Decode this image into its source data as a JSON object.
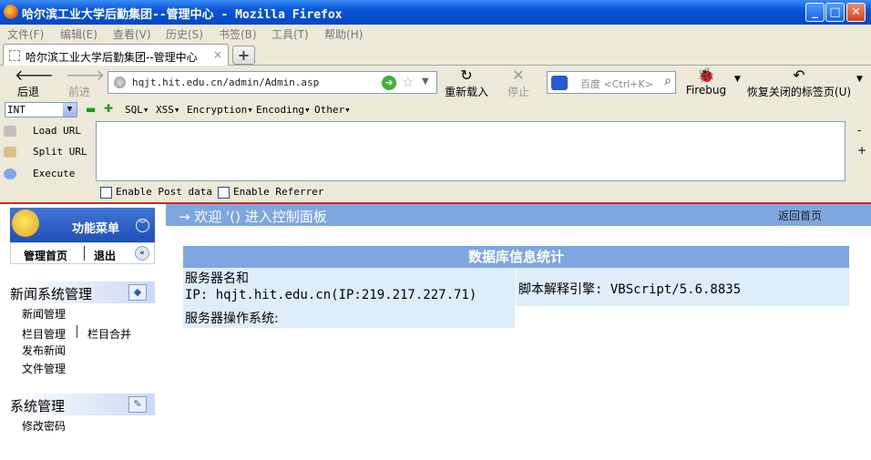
{
  "window": {
    "title": "哈尔滨工业大学后勤集团--管理中心 - Mozilla Firefox",
    "minimize_glyph": "_",
    "maximize_glyph": "□",
    "close_glyph": "✕"
  },
  "menubar": [
    "文件(F)",
    "编辑(E)",
    "查看(V)",
    "历史(S)",
    "书签(B)",
    "工具(T)",
    "帮助(H)"
  ],
  "tab": {
    "label": "哈尔滨工业大学后勤集团--管理中心",
    "close": "×",
    "new_tab": "+"
  },
  "nav": {
    "back": "后退",
    "forward": "前进",
    "reload": "重新载入",
    "stop": "停止",
    "url": "hqjt.hit.edu.cn/admin/Admin.asp",
    "search_engine": "百度",
    "search_placeholder": "<Ctrl+K>",
    "firebug": "Firebug",
    "restore_tabs": "恢复关闭的标签页(U)"
  },
  "hackbar": {
    "select_value": "INT",
    "menus": [
      "SQL▾",
      "XSS▾",
      "Encryption▾",
      "Encoding▾",
      "Other▾"
    ],
    "load_url": "Load URL",
    "split_url": "Split URL",
    "execute": "Execute",
    "enable_post": "Enable Post data",
    "enable_referrer": "Enable Referrer",
    "minus": "-",
    "plus": "+"
  },
  "sidebar": {
    "header": "功能菜单",
    "home": "管理首页",
    "logout": "退出",
    "sections": [
      {
        "title": "新闻系统管理",
        "items": [
          "新闻管理",
          "栏目管理",
          "栏目合并",
          "发布新闻",
          "文件管理"
        ]
      },
      {
        "title": "系统管理",
        "items": [
          "修改密码"
        ]
      }
    ]
  },
  "main": {
    "welcome": "→ 欢迎 '() 进入控制面板",
    "return_home": "返回首页",
    "db_title": "数据库信息统计",
    "server_name_label": "服务器名和",
    "server_ip": "IP: hqjt.hit.edu.cn(IP:219.217.227.71)",
    "script_engine": "脚本解释引擎: VBScript/5.6.8835",
    "server_os": "服务器操作系统:"
  }
}
